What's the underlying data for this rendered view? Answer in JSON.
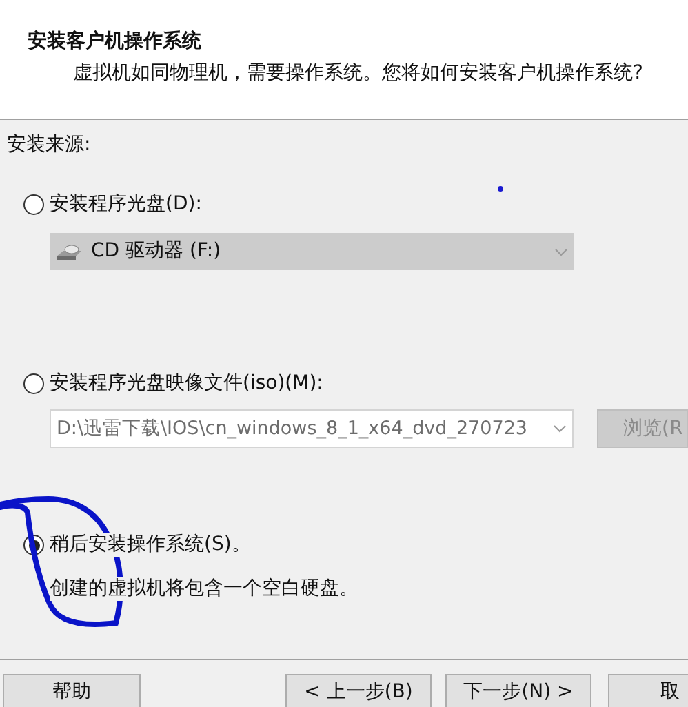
{
  "header": {
    "title": "安装客户机操作系统",
    "subtitle": "虚拟机如同物理机，需要操作系统。您将如何安装客户机操作系统?"
  },
  "source_label": "安装来源:",
  "options": [
    {
      "kind": "disc",
      "label": "安装程序光盘(D):",
      "selected": false,
      "control": {
        "value": "CD 驱动器 (F:)",
        "disabled": true
      }
    },
    {
      "kind": "iso",
      "label": "安装程序光盘映像文件(iso)(M):",
      "selected": false,
      "control": {
        "value": "D:\\迅雷下载\\IOS\\cn_windows_8_1_x64_dvd_270723",
        "disabled": true
      },
      "browse_button": {
        "label": "浏览(R",
        "disabled": true
      }
    },
    {
      "kind": "later",
      "label": "稍后安装操作系统(S)。",
      "selected": true,
      "note": "创建的虚拟机将包含一个空白硬盘。"
    }
  ],
  "buttons": [
    {
      "label": "帮助"
    },
    {
      "label": "< 上一步(B)"
    },
    {
      "label": "下一步(N) >"
    },
    {
      "label": "取"
    }
  ]
}
